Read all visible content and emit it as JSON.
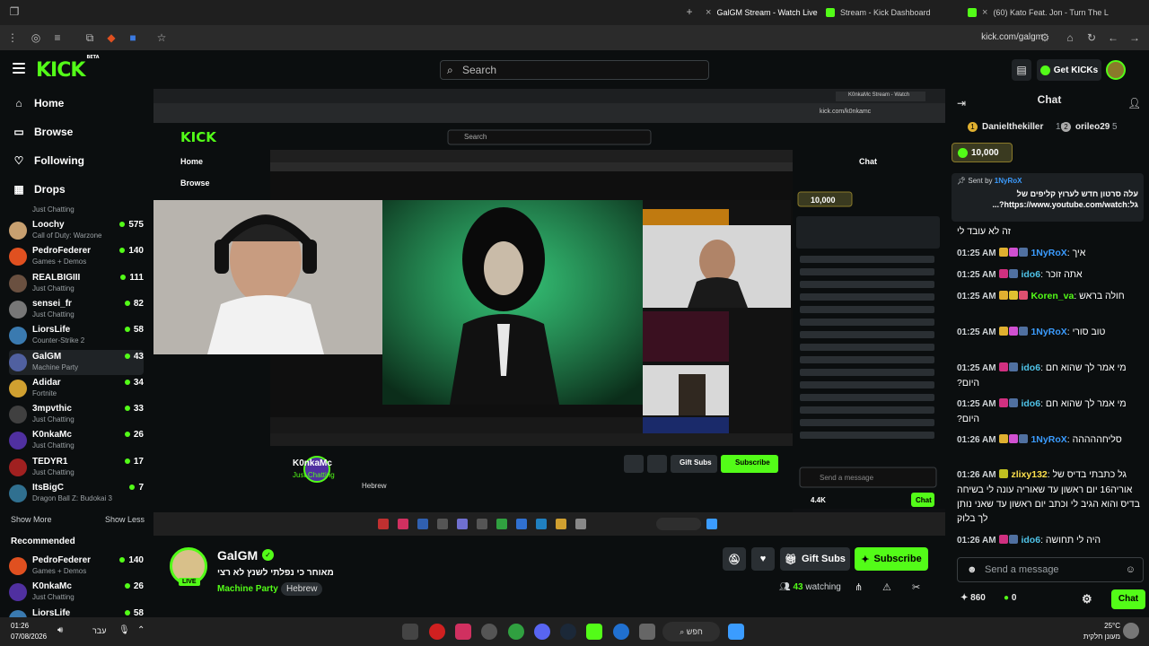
{
  "browser": {
    "tabs": [
      {
        "title": "GalGM Stream - Watch Live",
        "active": true
      },
      {
        "title": "Stream - Kick Dashboard",
        "active": false
      },
      {
        "title": "(60) Kato Feat. Jon - Turn The L",
        "active": false
      }
    ],
    "url": "kick.com/galgm"
  },
  "header": {
    "logo": "KICK",
    "logo_beta": "BETA",
    "search_placeholder": "Search",
    "get_kicks": "Get KICKs"
  },
  "sidebar": {
    "nav": [
      {
        "label": "Home",
        "icon": "home-icon"
      },
      {
        "label": "Browse",
        "icon": "browse-icon"
      },
      {
        "label": "Following",
        "icon": "heart-icon"
      },
      {
        "label": "Drops",
        "icon": "drops-icon"
      }
    ],
    "top_partial_category": "Just Chatting",
    "following": [
      {
        "name": "Loochy",
        "category": "Call of Duty: Warzone",
        "viewers": "575",
        "color": "#c8a070"
      },
      {
        "name": "PedroFederer",
        "category": "Games + Demos",
        "viewers": "140",
        "color": "#e05020"
      },
      {
        "name": "REALBIGIII",
        "category": "Just Chatting",
        "viewers": "111",
        "color": "#6a5040"
      },
      {
        "name": "sensei_fr",
        "category": "Just Chatting",
        "viewers": "82",
        "color": "#777777"
      },
      {
        "name": "LiorsLife",
        "category": "Counter-Strike 2",
        "viewers": "58",
        "color": "#3a7ab0"
      },
      {
        "name": "GalGM",
        "category": "Machine Party",
        "viewers": "43",
        "color": "#5060a0",
        "selected": true
      },
      {
        "name": "Adidar",
        "category": "Fortnite",
        "viewers": "34",
        "color": "#d0a030"
      },
      {
        "name": "3mpvthic",
        "category": "Just Chatting",
        "viewers": "33",
        "color": "#404040"
      },
      {
        "name": "K0nkaMc",
        "category": "Just Chatting",
        "viewers": "26",
        "color": "#5030a0"
      },
      {
        "name": "TEDYR1",
        "category": "Just Chatting",
        "viewers": "17",
        "color": "#a02020"
      },
      {
        "name": "ItsBigC",
        "category": "Dragon Ball Z: Budokai 3",
        "viewers": "7",
        "color": "#307090"
      }
    ],
    "show_more": "Show More",
    "show_less": "Show Less",
    "recommended_heading": "Recommended",
    "recommended": [
      {
        "name": "PedroFederer",
        "category": "Games + Demos",
        "viewers": "140",
        "color": "#e05020"
      },
      {
        "name": "K0nkaMc",
        "category": "Just Chatting",
        "viewers": "26",
        "color": "#5030a0"
      },
      {
        "name": "LiorsLife",
        "category": "",
        "viewers": "58",
        "color": "#3a7ab0"
      }
    ]
  },
  "stream": {
    "streamer": "GalGM",
    "title": "מאוחר כי נפלתי לשנץ לא רצי",
    "category": "Machine Party",
    "language": "Hebrew",
    "live_label": "LIVE",
    "gift_subs": "Gift Subs",
    "subscribe": "Subscribe",
    "viewers": "43",
    "watching_label": "watching"
  },
  "video_overlay": {
    "inner_search": "Search",
    "inner_chat": "Chat",
    "inner_send": "Send a message",
    "overlay_user": "K0nkaMc",
    "overlay_cat": "Just Chatting",
    "overlay_lang": "Hebrew",
    "overlay_gift": "Gift Subs",
    "overlay_sub": "Subscribe",
    "overlay_viewers": "4.4K",
    "inner_home": "Home",
    "inner_browse": "Browse",
    "inner_url": "kick.com/k0nkamc",
    "inner_tab": "K0nkaMc Stream - Watch"
  },
  "chat": {
    "title": "Chat",
    "leaderboard": [
      {
        "rank": "1",
        "name": "Danielthekiller",
        "value": "10"
      },
      {
        "rank": "2",
        "name": "orileo29",
        "value": "5"
      }
    ],
    "kicks_pill": "10,000",
    "pinned": {
      "sent_by_label": "Sent by",
      "sent_by_user": "1NyRoX",
      "message": "עלה סרטון חדש לערוץ קליפים של גל:https://www.youtube.com/watch?..."
    },
    "messages": [
      {
        "time": "",
        "user": "",
        "color": "#ffffff",
        "text": "זה לא עובד לי"
      },
      {
        "time": "01:25 AM",
        "user": "1NyRoX",
        "color": "#3b9cff",
        "text": "איך"
      },
      {
        "time": "01:25 AM",
        "user": "ido6",
        "color": "#4fc3e8",
        "text": "אתה זוכר"
      },
      {
        "time": "01:25 AM",
        "user": "Koren_va",
        "color": "#53fc18",
        "text": "חולה בראש"
      },
      {
        "time": "01:25 AM",
        "user": "1NyRoX",
        "color": "#3b9cff",
        "text": "טוב סורי"
      },
      {
        "time": "01:25 AM",
        "user": "ido6",
        "color": "#4fc3e8",
        "text": "מי אמר לך שהוא חם היום?"
      },
      {
        "time": "01:25 AM",
        "user": "ido6",
        "color": "#4fc3e8",
        "text": "מי אמר לך שהוא חם היום?"
      },
      {
        "time": "01:26 AM",
        "user": "1NyRoX",
        "color": "#3b9cff",
        "text": "סליחההההה"
      },
      {
        "time": "01:26 AM",
        "user": "zlixy132",
        "color": "#ffe14d",
        "text": "גל כתבתי בדיס של אוריה16 יום ראשון עד שאוריה עונה לי בשיחה בדיס והוא הגיב לי וכתב יום ראשון עד שאני נותן לך בלוק"
      },
      {
        "time": "01:26 AM",
        "user": "ido6",
        "color": "#4fc3e8",
        "text": "היה לי תחושה"
      }
    ],
    "send_placeholder": "Send a message",
    "points": "860",
    "kicks_balance": "0",
    "chat_button": "Chat"
  },
  "taskbar": {
    "time": "01:26",
    "date": "07/08/2026",
    "lang": "עבר",
    "search": "חפש",
    "temp": "25°C",
    "weather": "מעונן חלקית"
  }
}
